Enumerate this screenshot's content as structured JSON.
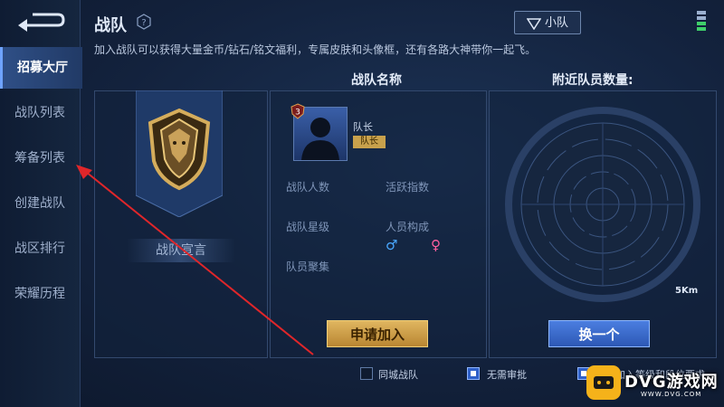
{
  "header": {
    "title": "战队",
    "intro": "加入战队可以获得大量金币/钻石/铭文福利，专属皮肤和头像框，还有各路大神带你一起飞。",
    "squad_button": "小队"
  },
  "sidebar": {
    "items": [
      {
        "label": "招募大厅",
        "active": true
      },
      {
        "label": "战队列表",
        "active": false
      },
      {
        "label": "筹备列表",
        "active": false
      },
      {
        "label": "创建战队",
        "active": false
      },
      {
        "label": "战区排行",
        "active": false
      },
      {
        "label": "荣耀历程",
        "active": false
      }
    ]
  },
  "team": {
    "name_header": "战队名称",
    "manifesto": "战队宣言",
    "leader_name": "队长",
    "leader_tag": "队长",
    "leader_level": "3",
    "stats": {
      "member_count": "战队人数",
      "activity": "活跃指数",
      "star_level": "战队星级",
      "composition": "人员构成",
      "gathering": "队员聚集"
    },
    "male_symbol": "♂",
    "female_symbol": "♀",
    "apply_button": "申请加入"
  },
  "nearby": {
    "header": "附近队员数量:",
    "distance": "5Km",
    "swap_button": "换一个"
  },
  "filters": {
    "same_city": {
      "label": "同城战队",
      "checked": false
    },
    "no_approval": {
      "label": "无需审批",
      "checked": true
    },
    "requirement": {
      "label": "符合加入等级和段位要求",
      "checked": true
    }
  },
  "watermark": {
    "main": "DVG游戏网",
    "sub": "WWW.DVG.COM"
  },
  "colors": {
    "accent_gold": "#c8a14c",
    "accent_blue": "#2f60c8",
    "male": "#4aa8ff",
    "female": "#ff5fa0",
    "arrow": "#e0262a"
  }
}
